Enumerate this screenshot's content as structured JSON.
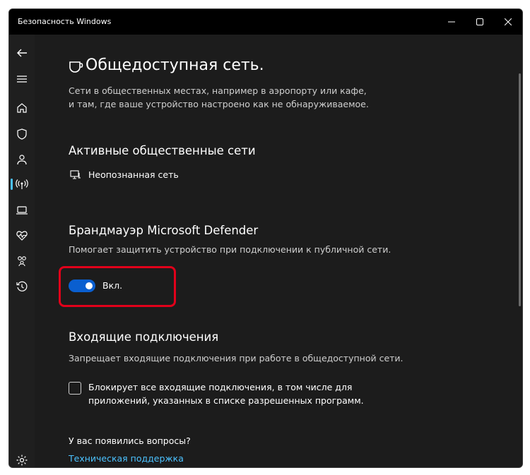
{
  "window": {
    "title": "Безопасность Windows",
    "controls": [
      "minimize-icon",
      "maximize-icon",
      "close-icon"
    ]
  },
  "sidebar": {
    "items": [
      {
        "icon": "back-arrow-icon"
      },
      {
        "icon": "hamburger-menu-icon"
      },
      {
        "icon": "home-icon"
      },
      {
        "icon": "shield-icon"
      },
      {
        "icon": "person-icon"
      },
      {
        "icon": "wireless-antenna-icon",
        "active": true
      },
      {
        "icon": "laptop-icon"
      },
      {
        "icon": "heart-pulse-icon"
      },
      {
        "icon": "family-icon"
      },
      {
        "icon": "history-icon"
      },
      {
        "icon": "gear-icon"
      }
    ]
  },
  "page": {
    "icon": "coffee-cup-icon",
    "title": "Общедоступная сеть.",
    "description": "Сети в общественных местах, например в аэропорту или кафе, и там, где ваше устройство настроено как не обнаруживаемое."
  },
  "active_networks": {
    "title": "Активные общественные сети",
    "network_icon": "network-computer-icon",
    "network_name": "Неопознанная сеть"
  },
  "firewall": {
    "title": "Брандмауэр Microsoft Defender",
    "subtitle": "Помогает защитить устройство при подключении к публичной сети.",
    "toggle_on": true,
    "toggle_label": "Вкл."
  },
  "incoming": {
    "title": "Входящие подключения",
    "subtitle": "Запрещает входящие подключения при работе в общедоступной сети.",
    "checkbox_checked": false,
    "checkbox_label": "Блокирует все входящие подключения, в том числе для приложений, указанных в списке разрешенных программ."
  },
  "help": {
    "question": "У вас появились вопросы?",
    "link": "Техническая поддержка"
  },
  "colors": {
    "accent": "#4cc2ff",
    "toggle_on": "#0a5fd0",
    "highlight": "#e1001a",
    "background": "#1c1c1c"
  }
}
